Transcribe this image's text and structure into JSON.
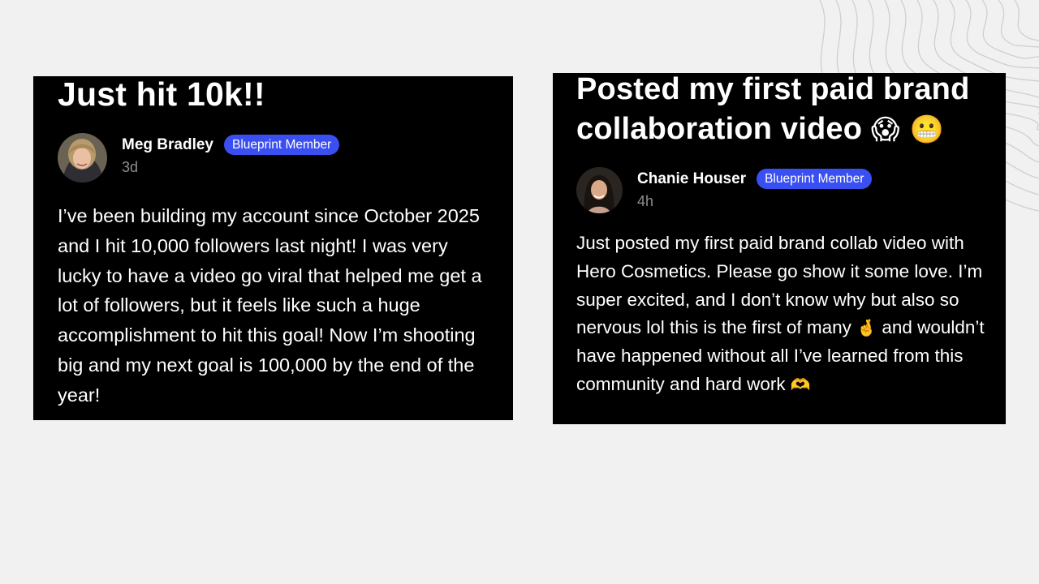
{
  "posts": [
    {
      "title": "Just hit 10k!!",
      "author": "Meg Bradley",
      "badge": "Blueprint Member",
      "time": "3d",
      "body": "I’ve been building my account since October 2025 and I hit 10,000 followers last night! I was very lucky to have a video go viral that helped me get a lot of followers, but it feels like such a huge accomplishment to hit this goal! Now I’m shooting big and my next goal is 100,000 by the end of the year!"
    },
    {
      "title": "Posted my first paid brand collaboration video",
      "title_emojis": "😱 😬",
      "author": "Chanie Houser",
      "badge": "Blueprint Member",
      "time": "4h",
      "body_part1": "Just posted my first paid brand collab video with Hero Cosmetics. Please go show it some love. I’m super excited, and I don’t know why but also so nervous lol this is the first of many",
      "body_emoji1": "🤞",
      "body_part2": "and wouldn’t have happened without all I’ve learned from this community and hard work",
      "body_emoji2": "🫶"
    }
  ],
  "colors": {
    "background": "#f1f1f1",
    "card": "#000000",
    "badge": "#3a4ff2",
    "muted": "#8e8e8e"
  }
}
